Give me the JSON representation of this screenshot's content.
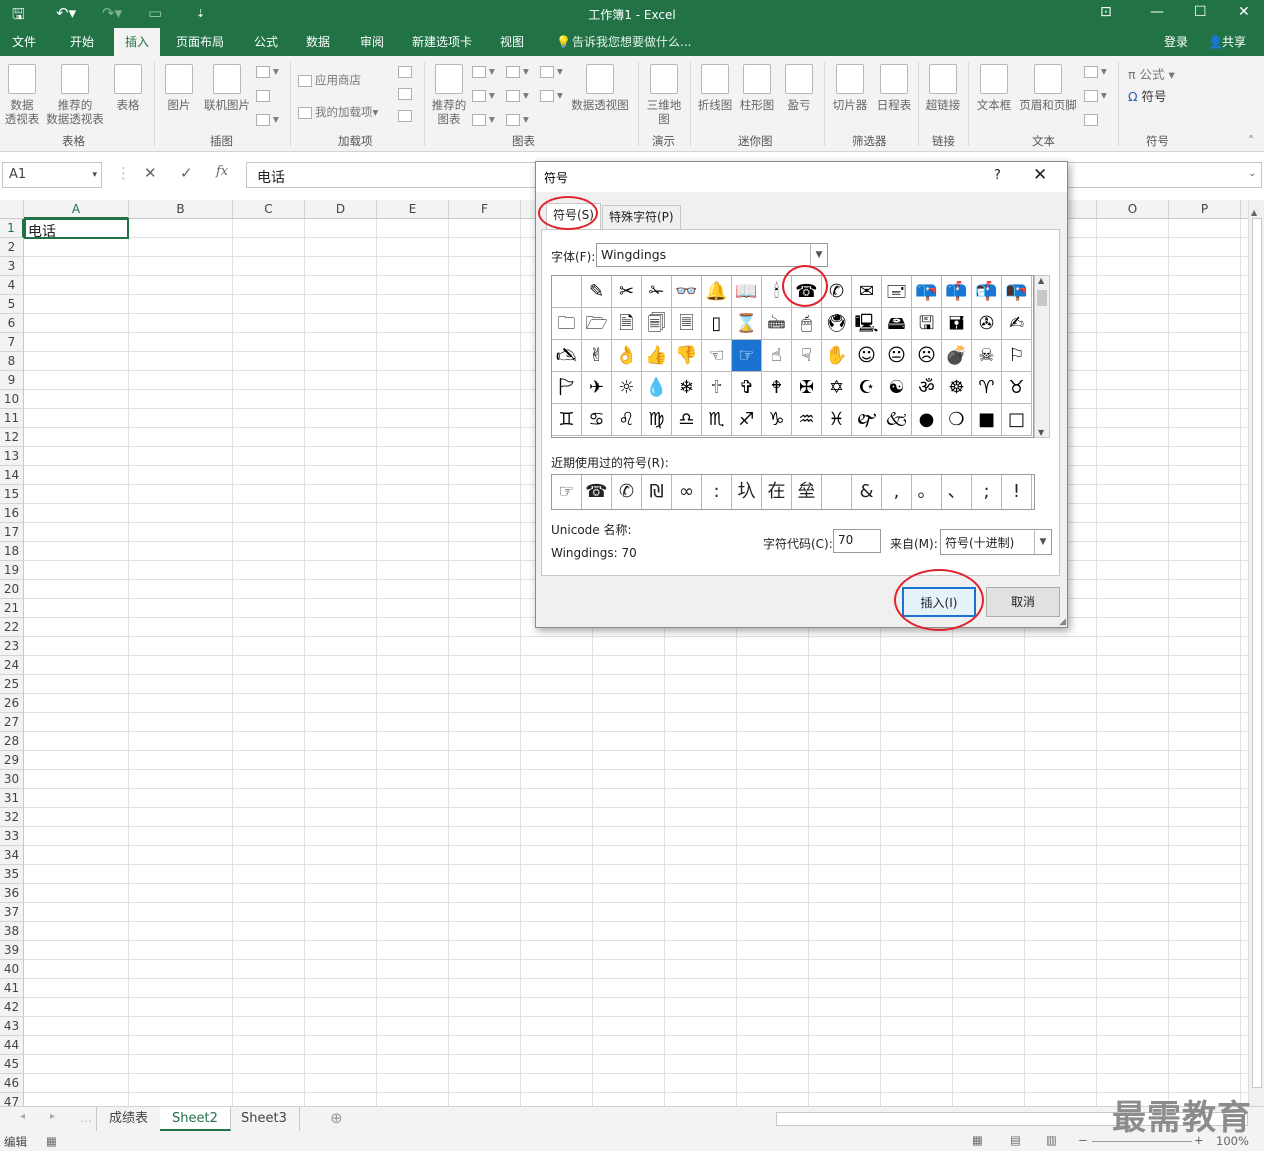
{
  "window": {
    "title": "工作簿1 - Excel"
  },
  "quick_access": {
    "save_icon": "save-icon",
    "undo_icon": "undo-icon",
    "redo_icon": "redo-icon",
    "new_icon": "new-doc-icon",
    "customize_icon": "customize-icon"
  },
  "tabs": [
    {
      "label": "文件"
    },
    {
      "label": "开始"
    },
    {
      "label": "插入"
    },
    {
      "label": "页面布局"
    },
    {
      "label": "公式"
    },
    {
      "label": "数据"
    },
    {
      "label": "审阅"
    },
    {
      "label": "新建选项卡"
    },
    {
      "label": "视图"
    }
  ],
  "tell_me": "告诉我您想要做什么...",
  "account": {
    "login": "登录",
    "share": "共享"
  },
  "ribbon": {
    "pivot": "数据\n透视表",
    "pivot_l1": "数据",
    "pivot_l2": "透视表",
    "rec_pivot_l1": "推荐的",
    "rec_pivot_l2": "数据透视表",
    "table": "表格",
    "picture": "图片",
    "online_picture": "联机图片",
    "app_store": "应用商店",
    "my_addins": "我的加载项",
    "rec_chart_l1": "推荐的",
    "rec_chart_l2": "图表",
    "pivot_chart": "数据透视图",
    "map_l1": "三维地",
    "map_l2": "图",
    "line": "折线图",
    "column": "柱形图",
    "winloss": "盈亏",
    "slicer": "切片器",
    "timeline": "日程表",
    "hyperlink": "超链接",
    "textbox": "文本框",
    "header_footer": "页眉和页脚",
    "equation": "公式",
    "symbol": "符号",
    "groups": {
      "tables": "表格",
      "illustrations": "插图",
      "addins": "加载项",
      "charts": "图表",
      "tours": "演示",
      "sparklines": "迷你图",
      "filters": "筛选器",
      "links": "链接",
      "text": "文本",
      "symbols": "符号"
    }
  },
  "formula_bar": {
    "name_box": "A1",
    "fx": "fx",
    "value": "电话"
  },
  "columns": [
    "A",
    "B",
    "C",
    "D",
    "E",
    "F",
    "O",
    "P"
  ],
  "rows": [
    "1",
    "2",
    "3",
    "4",
    "5",
    "6",
    "7",
    "8",
    "9",
    "10",
    "11",
    "12",
    "13",
    "14",
    "15",
    "16",
    "17",
    "18",
    "19",
    "20",
    "21",
    "22",
    "23",
    "24",
    "25",
    "26",
    "27",
    "28",
    "29",
    "30",
    "31",
    "32",
    "33",
    "34",
    "35",
    "36",
    "37",
    "38",
    "39",
    "40",
    "41",
    "42",
    "43",
    "44",
    "45",
    "46",
    "47"
  ],
  "cell_A1": "电话",
  "sheets": [
    {
      "label": "成绩表"
    },
    {
      "label": "Sheet2"
    },
    {
      "label": "Sheet3"
    }
  ],
  "status": {
    "mode": "编辑",
    "zoom": "100%"
  },
  "watermark": "最需教育",
  "dialog": {
    "title": "符号",
    "help": "?",
    "tab_symbols": "符号(S)",
    "tab_special": "特殊字符(P)",
    "font_label": "字体(F):",
    "font_value": "Wingdings",
    "symbols": [
      " ",
      "✎",
      "✂",
      "✁",
      "👓",
      "🔔",
      "📖",
      "🕯",
      "☎",
      "✆",
      "✉",
      "🖃",
      "📪",
      "📫",
      "📬",
      "📭",
      "🗀",
      "🗁",
      "🗎",
      "🗐",
      "🗏",
      "▯",
      "⌛",
      "🖮",
      "🖱",
      "🖲",
      "🖳",
      "🖴",
      "🖫",
      "🖬",
      "✇",
      "✍",
      "🖎",
      "✌",
      "👌",
      "👍",
      "👎",
      "☜",
      "☞",
      "☝",
      "☟",
      "✋",
      "☺",
      "😐",
      "☹",
      "💣",
      "☠",
      "⚐",
      "🏱",
      "✈",
      "☼",
      "💧",
      "❄",
      "🕆",
      "✞",
      "🕈",
      "✠",
      "✡",
      "☪",
      "☯",
      "ॐ",
      "☸",
      "♈",
      "♉",
      "♊",
      "♋",
      "♌",
      "♍",
      "♎",
      "♏",
      "♐",
      "♑",
      "♒",
      "♓",
      "🙰",
      "🙵",
      "●",
      "❍",
      "■",
      "□"
    ],
    "selected_index": 38,
    "recent_label": "近期使用过的符号(R):",
    "recent": [
      "☞",
      "☎",
      "✆",
      "₪",
      "∞",
      ":",
      "圦",
      "在",
      "垒",
      " ",
      "&",
      ",",
      "。",
      "、",
      ";",
      "!"
    ],
    "unicode_name_label": "Unicode 名称:",
    "unicode_name_value": "Wingdings: 70",
    "char_code_label": "字符代码(C):",
    "char_code_value": "70",
    "from_label": "来自(M):",
    "from_value": "符号(十进制)",
    "insert": "插入(I)",
    "cancel": "取消"
  }
}
